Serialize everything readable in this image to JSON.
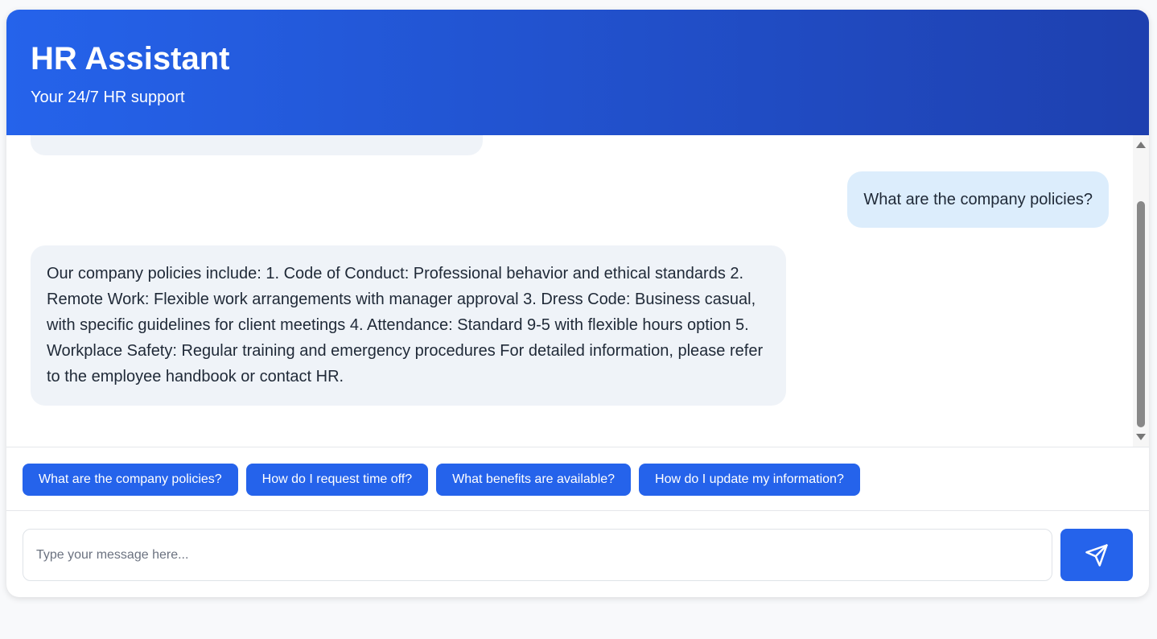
{
  "header": {
    "title": "HR Assistant",
    "subtitle": "Your 24/7 HR support"
  },
  "messages": [
    {
      "role": "user",
      "text": "What are the company policies?"
    },
    {
      "role": "assistant",
      "text": "Our company policies include: 1. Code of Conduct: Professional behavior and ethical standards 2. Remote Work: Flexible work arrangements with manager approval 3. Dress Code: Business casual, with specific guidelines for client meetings 4. Attendance: Standard 9-5 with flexible hours option 5. Workplace Safety: Regular training and emergency procedures For detailed information, please refer to the employee handbook or contact HR."
    }
  ],
  "quick_replies": [
    "What are the company policies?",
    "How do I request time off?",
    "What benefits are available?",
    "How do I update my information?"
  ],
  "input": {
    "placeholder": "Type your message here...",
    "value": ""
  },
  "send": {
    "icon": "send-icon"
  },
  "colors": {
    "primary": "#2563eb",
    "header_gradient_end": "#1e40af",
    "user_bubble": "#dcedfc",
    "bot_bubble": "#eff3f8"
  }
}
